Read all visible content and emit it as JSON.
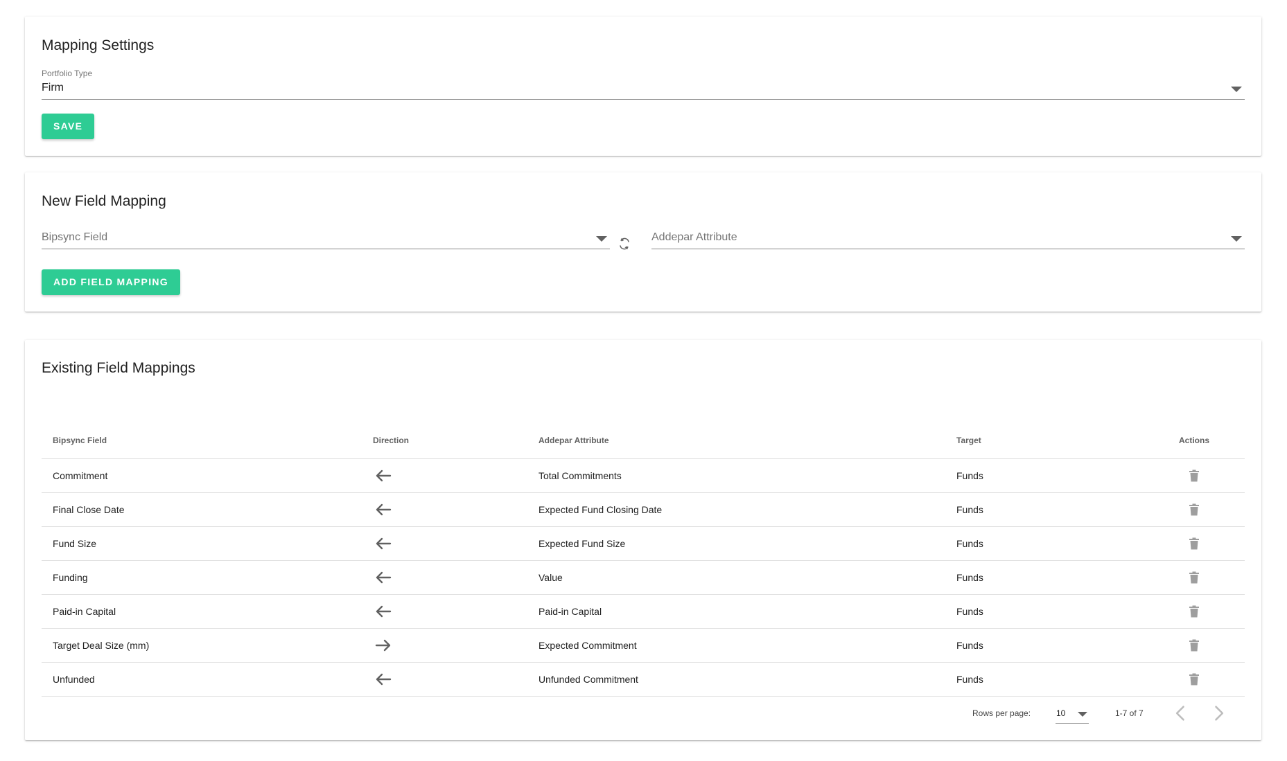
{
  "mapping_settings": {
    "title": "Mapping Settings",
    "portfolio_type_label": "Portfolio Type",
    "portfolio_type_value": "Firm",
    "save_label": "SAVE"
  },
  "new_field_mapping": {
    "title": "New Field Mapping",
    "bipsync_field_placeholder": "Bipsync Field",
    "addepar_attribute_placeholder": "Addepar Attribute",
    "add_button_label": "ADD FIELD MAPPING"
  },
  "existing_field_mappings": {
    "title": "Existing Field Mappings",
    "columns": [
      "Bipsync Field",
      "Direction",
      "Addepar Attribute",
      "Target",
      "Actions"
    ],
    "rows": [
      {
        "bipsync_field": "Commitment",
        "direction": "left",
        "addepar_attribute": "Total Commitments",
        "target": "Funds"
      },
      {
        "bipsync_field": "Final Close Date",
        "direction": "left",
        "addepar_attribute": "Expected Fund Closing Date",
        "target": "Funds"
      },
      {
        "bipsync_field": "Fund Size",
        "direction": "left",
        "addepar_attribute": "Expected Fund Size",
        "target": "Funds"
      },
      {
        "bipsync_field": "Funding",
        "direction": "left",
        "addepar_attribute": "Value",
        "target": "Funds"
      },
      {
        "bipsync_field": "Paid-in Capital",
        "direction": "left",
        "addepar_attribute": "Paid-in Capital",
        "target": "Funds"
      },
      {
        "bipsync_field": "Target Deal Size (mm)",
        "direction": "right",
        "addepar_attribute": "Expected Commitment",
        "target": "Funds"
      },
      {
        "bipsync_field": "Unfunded",
        "direction": "left",
        "addepar_attribute": "Unfunded Commitment",
        "target": "Funds"
      }
    ],
    "pagination": {
      "rows_per_page_label": "Rows per page:",
      "rows_per_page_value": "10",
      "range_label": "1-7 of 7"
    }
  },
  "colors": {
    "accent": "#2ecc94",
    "icon": "#616161",
    "divider": "#e0e0e0"
  },
  "icons": {
    "dropdown": "chevron-down-icon",
    "refresh": "refresh-icon",
    "direction_left": "arrow-left-icon",
    "direction_right": "arrow-right-icon",
    "delete": "trash-icon",
    "prev_page": "chevron-left-icon",
    "next_page": "chevron-right-icon"
  }
}
